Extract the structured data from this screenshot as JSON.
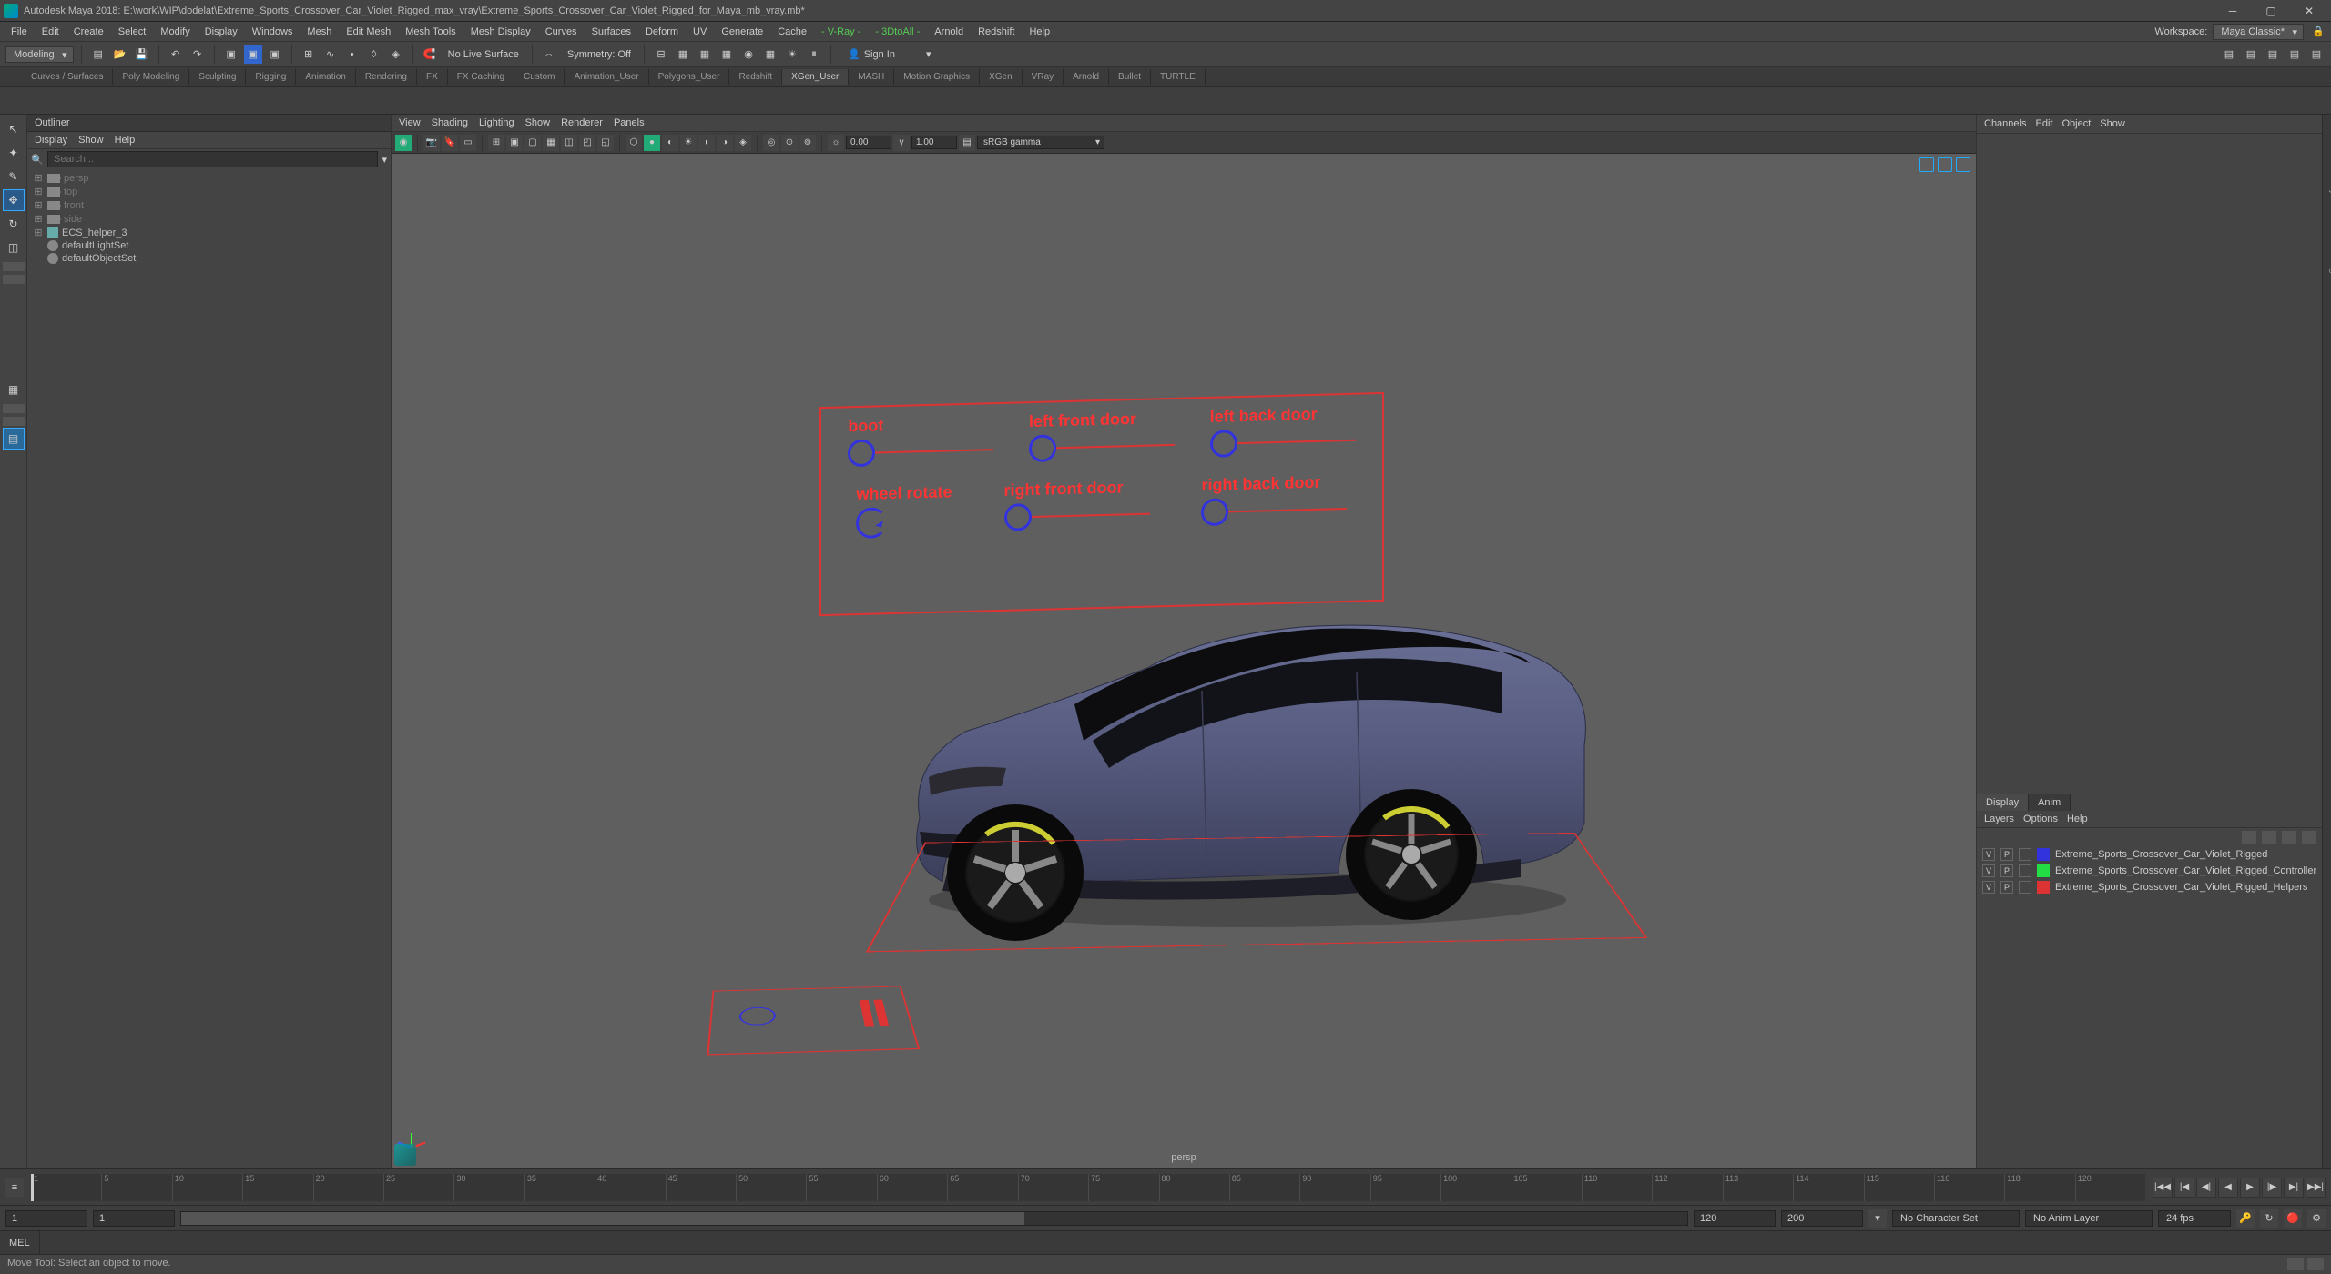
{
  "title": "Autodesk Maya 2018: E:\\work\\WIP\\dodelat\\Extreme_Sports_Crossover_Car_Violet_Rigged_max_vray\\Extreme_Sports_Crossover_Car_Violet_Rigged_for_Maya_mb_vray.mb*",
  "workspace_label": "Workspace:",
  "workspace_value": "Maya Classic*",
  "menus": [
    "File",
    "Edit",
    "Create",
    "Select",
    "Modify",
    "Display",
    "Windows",
    "Mesh",
    "Edit Mesh",
    "Mesh Tools",
    "Mesh Display",
    "Curves",
    "Surfaces",
    "Deform",
    "UV",
    "Generate",
    "Cache"
  ],
  "menus_plugins": [
    "V-Ray",
    "3DtoAll",
    "Arnold",
    "Redshift",
    "Help"
  ],
  "workspace_mode": "Modeling",
  "no_live_surface": "No Live Surface",
  "symmetry": "Symmetry: Off",
  "signin": "Sign In",
  "shelf_tabs": [
    "Curves / Surfaces",
    "Poly Modeling",
    "Sculpting",
    "Rigging",
    "Animation",
    "Rendering",
    "FX",
    "FX Caching",
    "Custom",
    "Animation_User",
    "Polygons_User",
    "Redshift",
    "XGen_User",
    "MASH",
    "Motion Graphics",
    "XGen",
    "VRay",
    "Arnold",
    "Bullet",
    "TURTLE"
  ],
  "shelf_active": "XGen_User",
  "outliner": {
    "title": "Outliner",
    "menu": [
      "Display",
      "Show",
      "Help"
    ],
    "search_placeholder": "Search...",
    "items": [
      {
        "type": "cam",
        "label": "persp",
        "dim": true,
        "exp": "⊞"
      },
      {
        "type": "cam",
        "label": "top",
        "dim": true,
        "exp": "⊞"
      },
      {
        "type": "cam",
        "label": "front",
        "dim": true,
        "exp": "⊞"
      },
      {
        "type": "cam",
        "label": "side",
        "dim": true,
        "exp": "⊞"
      },
      {
        "type": "grp",
        "label": "ECS_helper_3",
        "dim": false,
        "exp": "⊞"
      },
      {
        "type": "set",
        "label": "defaultLightSet",
        "dim": false,
        "exp": ""
      },
      {
        "type": "set",
        "label": "defaultObjectSet",
        "dim": false,
        "exp": ""
      }
    ]
  },
  "viewport": {
    "menu": [
      "View",
      "Shading",
      "Lighting",
      "Show",
      "Renderer",
      "Panels"
    ],
    "exposure": "0.00",
    "gamma": "1.00",
    "colorspace": "sRGB gamma",
    "camera": "persp"
  },
  "rig": {
    "top": [
      {
        "label": "boot"
      },
      {
        "label": "left front door"
      },
      {
        "label": "left back door"
      }
    ],
    "bottom": [
      {
        "label": "wheel rotate",
        "rot": true
      },
      {
        "label": "right front door"
      },
      {
        "label": "right back door"
      }
    ]
  },
  "right": {
    "menu": [
      "Channels",
      "Edit",
      "Object",
      "Show"
    ],
    "side_tabs": [
      "Channel Box / Layer Editor",
      "Modeling Toolkit"
    ],
    "bottom_tabs": [
      "Display",
      "Anim"
    ],
    "layers_menu": [
      "Layers",
      "Options",
      "Help"
    ],
    "layers": [
      {
        "v": "V",
        "p": "P",
        "color": "s-blue",
        "name": "Extreme_Sports_Crossover_Car_Violet_Rigged"
      },
      {
        "v": "V",
        "p": "P",
        "color": "s-green",
        "name": "Extreme_Sports_Crossover_Car_Violet_Rigged_Controller"
      },
      {
        "v": "V",
        "p": "P",
        "color": "s-red",
        "name": "Extreme_Sports_Crossover_Car_Violet_Rigged_Helpers"
      }
    ]
  },
  "time": {
    "start_abs": "1",
    "start": "1",
    "end": "120",
    "end_abs": "200",
    "charset": "No Character Set",
    "animlayer": "No Anim Layer",
    "fps": "24 fps",
    "ticks": [
      "1",
      "5",
      "10",
      "15",
      "20",
      "25",
      "30",
      "35",
      "40",
      "45",
      "50",
      "55",
      "60",
      "65",
      "70",
      "75",
      "80",
      "85",
      "90",
      "95",
      "100",
      "105",
      "110",
      "112",
      "113",
      "114",
      "115",
      "116",
      "118",
      "120"
    ]
  },
  "cmd": "MEL",
  "help": "Move Tool: Select an object to move."
}
